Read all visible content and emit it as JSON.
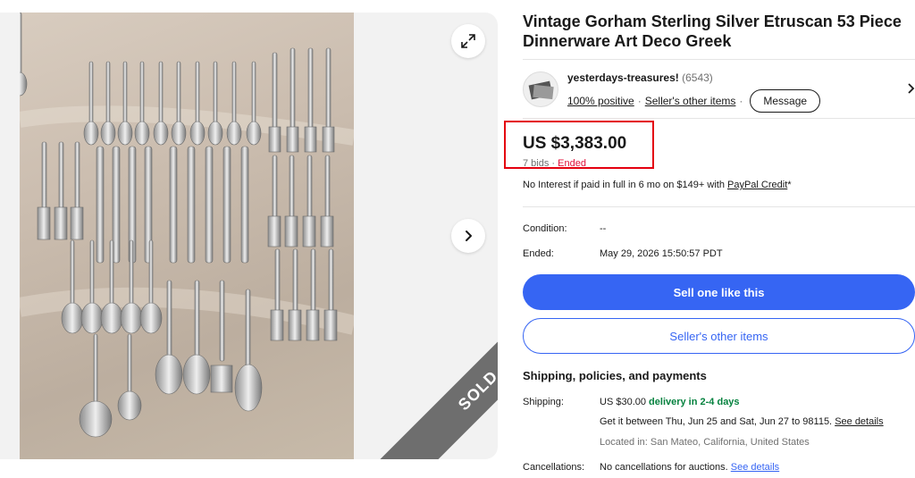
{
  "listing": {
    "title": "Vintage Gorham Sterling Silver Etruscan 53 Piece Dinnerware Art Deco Greek",
    "sold_badge": "SOLD"
  },
  "seller": {
    "name": "yesterdays-treasures!",
    "feedback_count": "(6543)",
    "positive": "100% positive",
    "other_items_link": "Seller's other items",
    "message_button": "Message"
  },
  "price": {
    "amount": "US $3,383.00",
    "bids": "7 bids",
    "separator": "·",
    "status": "Ended"
  },
  "financing": {
    "text": "No Interest if paid in full in 6 mo on $149+ with ",
    "link": "PayPal Credit",
    "suffix": "*"
  },
  "details": {
    "condition_label": "Condition:",
    "condition_value": "--",
    "ended_label": "Ended:",
    "ended_value": "May 29, 2026 15:50:57 PDT"
  },
  "actions": {
    "sell_one": "Sell one like this",
    "seller_other_items": "Seller's other items"
  },
  "shipping": {
    "section_title": "Shipping, policies, and payments",
    "label": "Shipping:",
    "cost": "US $30.00",
    "delivery": "delivery in 2-4 days",
    "estimate": "Get it between Thu, Jun 25 and Sat, Jun 27 to 98115.",
    "see_details": "See details",
    "located": "Located in: San Mateo, California, United States"
  },
  "cancellations": {
    "label": "Cancellations:",
    "value": "No cancellations for auctions.",
    "see_details": "See details"
  },
  "colors": {
    "brand_blue": "#3665f3",
    "ended_red": "#e0103a",
    "delivery_green": "#05823f",
    "highlight_red": "#e4000f"
  },
  "icons": [
    "expand-icon",
    "chevron-right-icon",
    "seller-avatar"
  ]
}
